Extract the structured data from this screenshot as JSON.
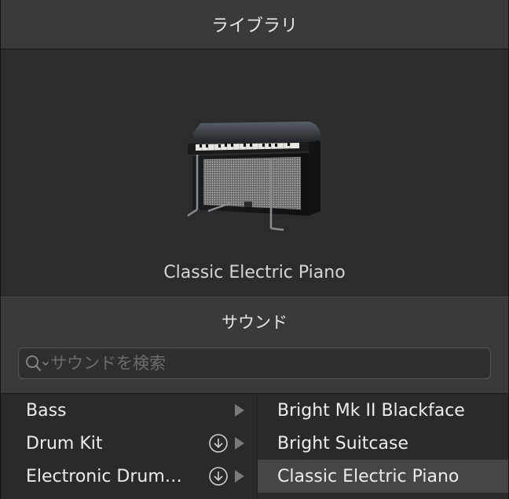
{
  "window": {
    "title": "ライブラリ"
  },
  "preview": {
    "name": "Classic Electric Piano",
    "image_icon": "electric-piano-icon"
  },
  "sounds": {
    "header": "サウンド",
    "search": {
      "placeholder": "サウンドを検索",
      "value": "",
      "icon": "search-icon"
    }
  },
  "categories": [
    {
      "label": "Bass",
      "download_icon": false,
      "arrow": true
    },
    {
      "label": "Drum Kit",
      "download_icon": true,
      "arrow": true
    },
    {
      "label": "Electronic Drum…",
      "download_icon": true,
      "arrow": true
    }
  ],
  "patches": [
    {
      "label": "Bright Mk II Blackface",
      "selected": false
    },
    {
      "label": "Bright Suitcase",
      "selected": false
    },
    {
      "label": "Classic Electric Piano",
      "selected": true
    }
  ],
  "colors": {
    "background": "#2b2b2b",
    "header_bg": "#3a3a3a",
    "selected_row": "#464646",
    "text": "#ececec",
    "placeholder": "#6c6c6c"
  }
}
